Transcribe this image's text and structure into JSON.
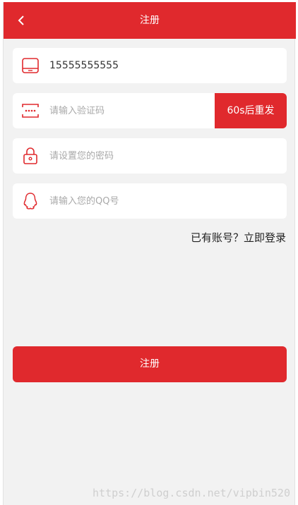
{
  "header": {
    "title": "注册",
    "back_icon": "chevron-left-icon"
  },
  "form": {
    "phone": {
      "value": "15555555555",
      "icon": "tablet-icon"
    },
    "code": {
      "placeholder": "请输入验证码",
      "icon": "password-dots-icon",
      "send_label": "60s后重发"
    },
    "password": {
      "placeholder": "请设置您的密码",
      "icon": "lock-icon"
    },
    "qq": {
      "placeholder": "请输入您的QQ号",
      "icon": "qq-icon"
    }
  },
  "login_link": "已有账号？立即登录",
  "register_label": "注册",
  "watermark": "https://blog.csdn.net/vipbin520",
  "colors": {
    "accent": "#e0292d",
    "background": "#f2f2f2"
  }
}
